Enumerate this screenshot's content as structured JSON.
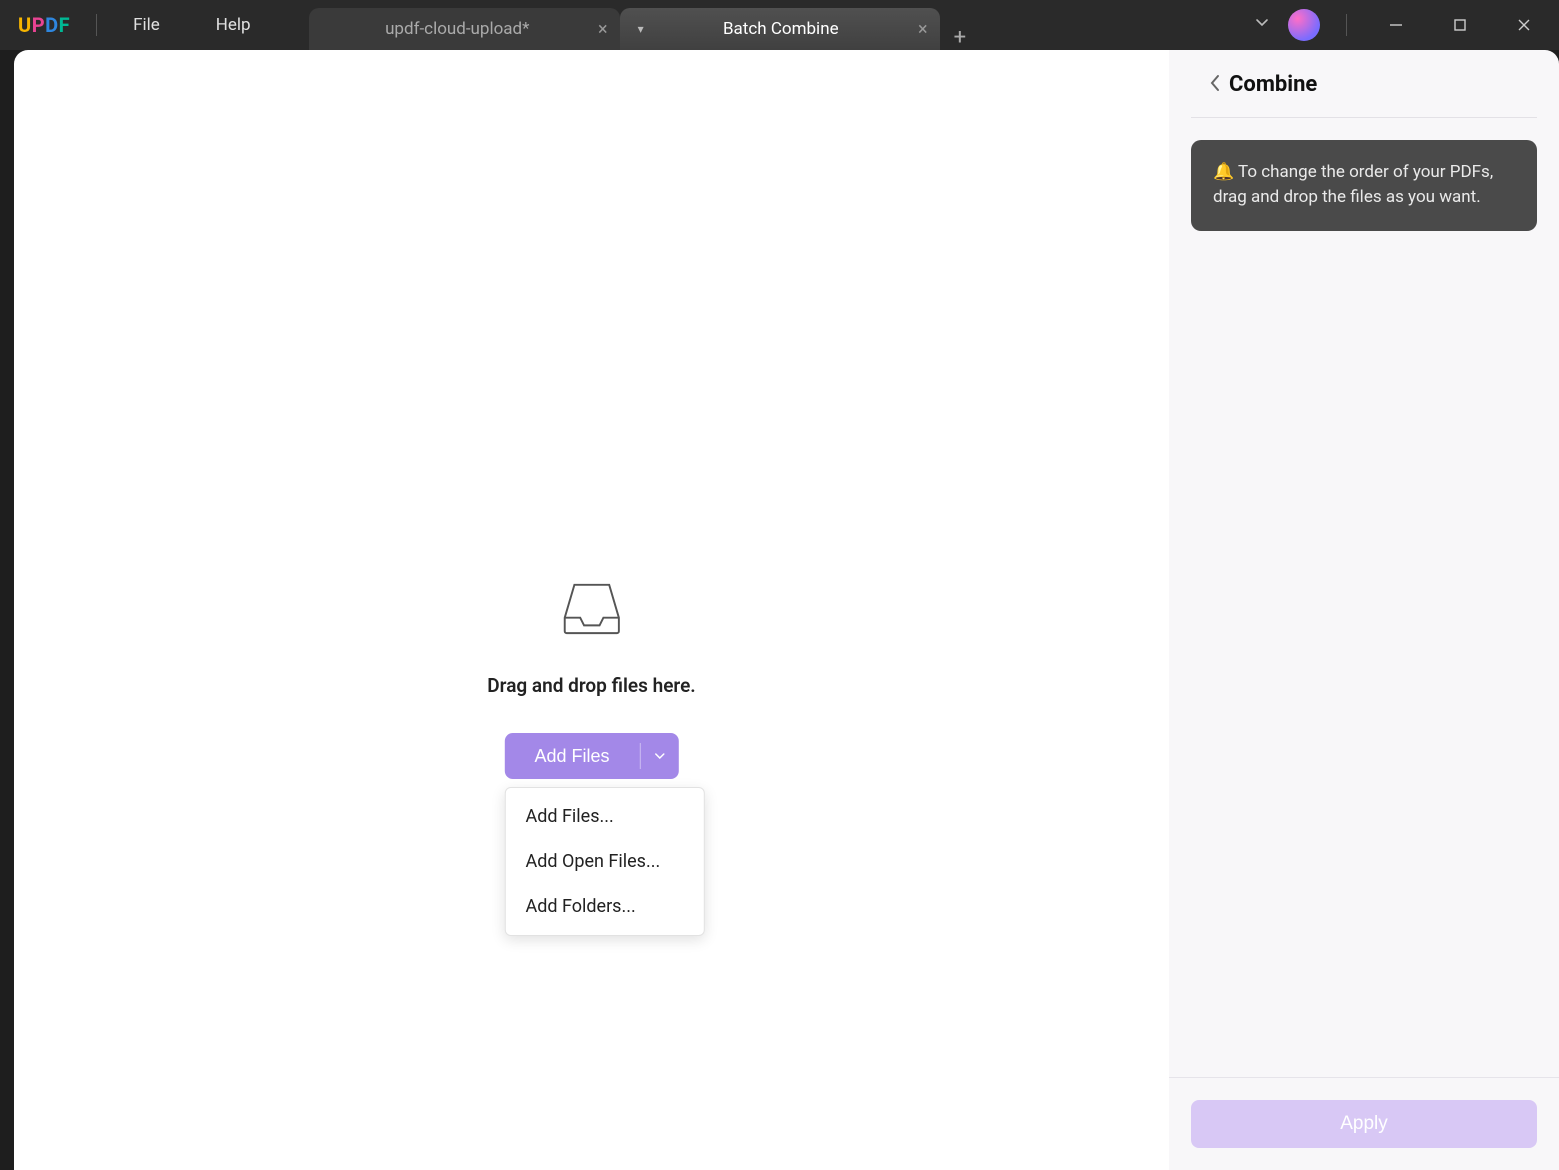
{
  "logo": {
    "u": "U",
    "p": "P",
    "d": "D",
    "f": "F"
  },
  "menu": {
    "file": "File",
    "help": "Help"
  },
  "tabs": {
    "t0": {
      "label": "updf-cloud-upload*"
    },
    "t1": {
      "label": "Batch Combine"
    }
  },
  "dropzone": {
    "text": "Drag and drop files here.",
    "button_label": "Add Files"
  },
  "dropdown": {
    "item0": "Add Files...",
    "item1": "Add Open Files...",
    "item2": "Add Folders..."
  },
  "side": {
    "title": "Combine",
    "tip": "🔔 To change the order of your PDFs, drag and drop the files as you want.",
    "apply": "Apply"
  }
}
